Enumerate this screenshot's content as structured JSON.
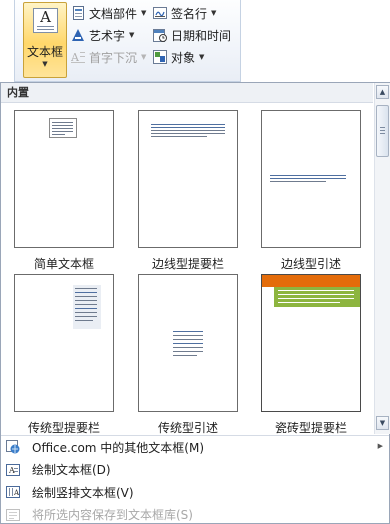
{
  "ribbon": {
    "textbox_label": "文本框",
    "textbox_icon_letter": "A",
    "items": [
      {
        "label": "文档部件",
        "icon": "doc-parts-icon"
      },
      {
        "label": "艺术字",
        "icon": "wordart-icon"
      },
      {
        "label": "首字下沉",
        "icon": "dropcap-icon"
      },
      {
        "label": "签名行",
        "icon": "signature-line-icon"
      },
      {
        "label": "日期和时间",
        "icon": "date-time-icon"
      },
      {
        "label": "对象",
        "icon": "object-icon"
      }
    ]
  },
  "gallery": {
    "section_title": "内置",
    "tiles": [
      {
        "label": "简单文本框"
      },
      {
        "label": "边线型提要栏"
      },
      {
        "label": "边线型引述"
      },
      {
        "label": "传统型提要栏"
      },
      {
        "label": "传统型引述"
      },
      {
        "label": "瓷砖型提要栏"
      }
    ]
  },
  "menu": {
    "items": [
      {
        "label": "Office.com 中的其他文本框(M)",
        "icon": "office-online-icon"
      },
      {
        "label": "绘制文本框(D)",
        "icon": "draw-textbox-icon"
      },
      {
        "label": "绘制竖排文本框(V)",
        "icon": "draw-vertical-textbox-icon"
      },
      {
        "label": "将所选内容保存到文本框库(S)",
        "icon": "save-selection-icon"
      }
    ]
  },
  "colors": {
    "accent": "#ffd76b",
    "tile_orange": "#e46c0a",
    "tile_green": "#8db53f"
  }
}
